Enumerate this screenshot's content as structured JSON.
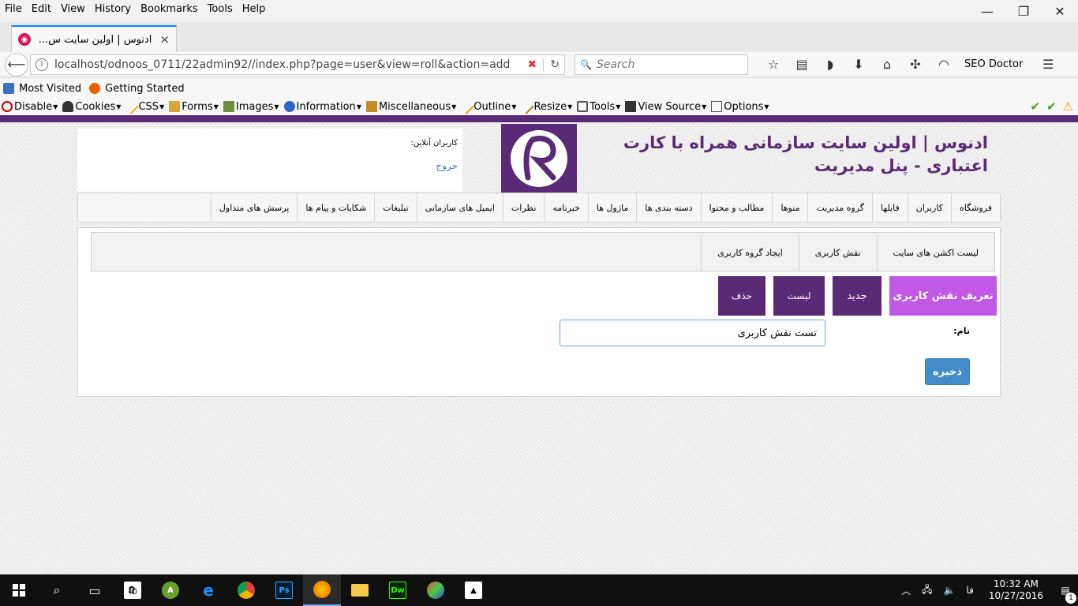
{
  "browser": {
    "menu": [
      "File",
      "Edit",
      "View",
      "History",
      "Bookmarks",
      "Tools",
      "Help"
    ],
    "tab_title": "ادنوس | اولین سایت س...",
    "tab_close": "×",
    "new_tab": "+",
    "url": "localhost/odnoos_0711/22admin92//index.php?page=user&view=roll&action=add",
    "search_placeholder": "Search",
    "seo_doctor": "SEO Doctor",
    "bookmarks": [
      "Most Visited",
      "Getting Started"
    ],
    "devbar": [
      "Disable",
      "Cookies",
      "CSS",
      "Forms",
      "Images",
      "Information",
      "Miscellaneous",
      "Outline",
      "Resize",
      "Tools",
      "View Source",
      "Options"
    ]
  },
  "header": {
    "online_users_label": "کاربران آنلاین:",
    "logout": "خروج",
    "logo_letter": "R",
    "site_title": "ادنوس | اولین سایت سازمانی همراه با کارت اعتباری - پنل مدیریت"
  },
  "main_nav": [
    "فروشگاه",
    "کاربران",
    "فایلها",
    "گروه مدیریت",
    "منوها",
    "مطالب و محتوا",
    "دسته بندی ها",
    "ماژول ها",
    "خبرنامه",
    "نظرات",
    "ایمیل های سازمانی",
    "تبلیغات",
    "شکایات و پیام ها",
    "پرسش های متداول"
  ],
  "sub_nav": [
    "لیست اکشن های سایت",
    "نقش کاربری",
    "ایجاد گروه کاربری"
  ],
  "actions": {
    "define_role": "تعریف نقش کاربری",
    "new": "جدید",
    "list": "لیست",
    "delete": "حذف"
  },
  "form": {
    "name_label": "نام:",
    "name_value": "تست نقش کاربری",
    "save": "ذخیره"
  },
  "taskbar": {
    "time": "10:32 AM",
    "date": "10/27/2016",
    "lang": "فا",
    "notifications": "1"
  },
  "colors": {
    "brand_purple": "#5b2a76",
    "accent_violet": "#c159e6",
    "save_blue": "#428bca"
  }
}
